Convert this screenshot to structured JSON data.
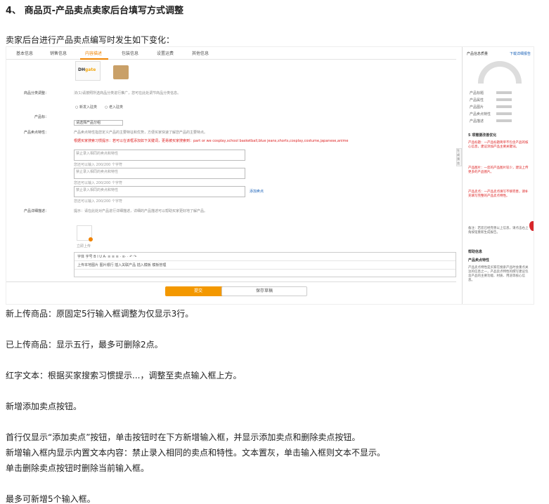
{
  "heading": "4、 商品页-产品卖点卖家后台填写方式调整",
  "intro": "卖家后台进行产品卖点编写时发生如下变化：",
  "screenshot": {
    "tabs": [
      "基本信息",
      "销售信息",
      "内容描述",
      "包装信息",
      "设置运费",
      "其他信息"
    ],
    "active_tab": 2,
    "thumb_logo_a": "DH",
    "thumb_logo_b": "gate",
    "label_category": "商品分类调整：",
    "label_title": "产品标：",
    "label_points": "产品卖点特性：",
    "label_detail": "产品详细描述：",
    "category_hint": "法(1)请按照所选商品分类进行推广，您可在此处调节商品分类信息。",
    "radio_1": "新发入驻类",
    "radio_2": "老入驻类",
    "select_value": "请选择产品分组",
    "points_hint": "产品卖点特性指您定义产品的主要特征和优势，方便买家快速了解您产品的主要特点。",
    "red_hint": "根据买家搜索习惯提示：若可以在该框添加如下关键词，更易被买家搜索到：part or we cosplay,school basketball,blue jeans,shorts,cosplay,costume,japanese,anime",
    "input_placeholder": "禁止录入相同的卖点和特性",
    "char_count": "您还可以输入 200/200 个字符",
    "add_point_link": "添加卖点",
    "detail_hint": "提示：请在此处对产品进行详细描述，详细的产品描述可以帮助买家更好地了解产品。",
    "img_caption": "立即上传",
    "editor_row1": "字体   字号   B  I  U  A·  ≡  ≡  ≡  ·  ≡·  ·  ↶  ↷",
    "editor_row2": "上传本地图片   图片银行   插入关联产品   插入模板   模板管理",
    "btn_submit": "提交",
    "btn_draft": "保存草稿",
    "side_tab": "生成预览",
    "panel": {
      "title": "产品信息质量",
      "link": "下载详细报告",
      "stat_1": "产品标题",
      "stat_2": "产品属性",
      "stat_3": "产品图片",
      "stat_4": "产品卖点特性",
      "stat_5": "产品描述",
      "section_1": "5 项需要改善优化",
      "red_1": "产品标题：一产品标题简单不包含产品的核心信息，建议添加产品主要关键词。",
      "red_2": "产品图片：一您的产品图片较少，建议上传更多的产品图片。",
      "red_3": "产品卖点：一产品卖点填写不够完善，请补充填写完整的产品卖点特性。",
      "gray_1": "备注：若您已经完善以上信息，请点击右上角按钮重新生成报告。",
      "section_2": "帮助信息",
      "section_3": "产品卖点特性",
      "gray_2": "产品卖点特性是买家在搜索产品时会重点关注的信息之一，产品卖点特性的撰写建议包含产品的主要功能、材质、用途等核心信息。"
    }
  },
  "notes": [
    "新上传商品：原固定5行输入框调整为仅显示3行。",
    "已上传商品：显示五行，最多可删除2点。",
    "红字文本：根据买家搜索习惯提示...，调整至卖点输入框上方。",
    "新增添加卖点按钮。",
    "首行仅显示“添加卖点”按钮，单击按钮时在下方新增输入框，并显示添加卖点和删除卖点按钮。",
    "新增输入框内显示内置文本内容：禁止录入相同的卖点和特性。文本置灰，单击输入框则文本不显示。",
    "单击删除卖点按钮时删除当前输入框。",
    "最多可新增5个输入框。"
  ]
}
